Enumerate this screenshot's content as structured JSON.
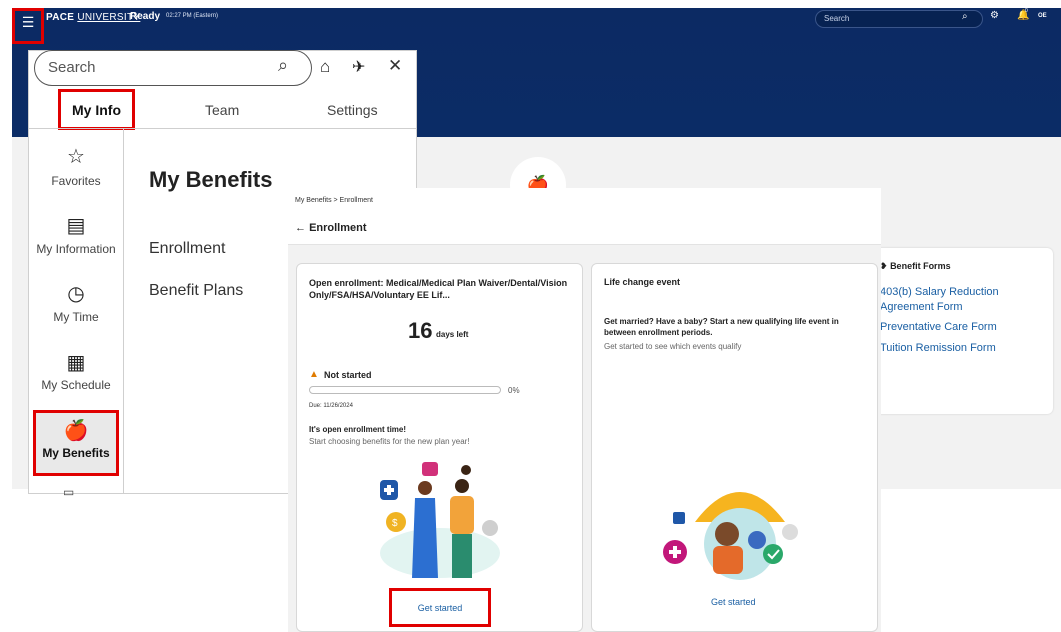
{
  "header": {
    "logo_bold": "PACE",
    "logo_rest": "UNIVERSITY",
    "status": "Ready",
    "time": "02:27 PM (Eastern)",
    "search_placeholder": "Search",
    "notification_count": "0",
    "user_initials": "OE"
  },
  "menu": {
    "search_placeholder": "Search",
    "tabs": [
      {
        "label": "My Info"
      },
      {
        "label": "Team"
      },
      {
        "label": "Settings"
      }
    ],
    "rail": [
      {
        "label": "Favorites",
        "icon": "star-icon"
      },
      {
        "label": "My Information",
        "icon": "id-card-icon"
      },
      {
        "label": "My Time",
        "icon": "clock-icon"
      },
      {
        "label": "My Schedule",
        "icon": "calendar-icon"
      },
      {
        "label": "My Benefits",
        "icon": "apple-icon"
      }
    ],
    "heading": "My Benefits",
    "links": [
      {
        "label": "Enrollment"
      },
      {
        "label": "Benefit Plans"
      }
    ]
  },
  "enrollment": {
    "breadcrumb": "My Benefits > Enrollment",
    "title": "Enrollment",
    "open_card": {
      "title": "Open enrollment: Medical/Medical Plan Waiver/Dental/Vision Only/FSA/HSA/Voluntary EE Lif...",
      "days_number": "16",
      "days_label": "days left",
      "status": "Not started",
      "progress": 0,
      "progress_label": "0%",
      "due": "Due: 11/26/2024",
      "promo_title": "It's open enrollment time!",
      "promo_subtitle": "Start choosing benefits for the new plan year!",
      "button": "Get started"
    },
    "life_card": {
      "title": "Life change event",
      "question": "Get married? Have a baby? Start a new qualifying life event in between enrollment periods.",
      "subtitle": "Get started to see which events qualify",
      "button": "Get started"
    }
  },
  "benefit_forms": {
    "title": "Benefit Forms",
    "links": [
      {
        "label": "403(b) Salary Reduction Agreement Form"
      },
      {
        "label": "Preventative Care Form"
      },
      {
        "label": "Tuition Remission Form"
      }
    ]
  },
  "colors": {
    "header_navy": "#0c2a63",
    "highlight_red": "#e00000",
    "link_blue": "#1a5fa3",
    "warning_orange": "#e07b00"
  }
}
